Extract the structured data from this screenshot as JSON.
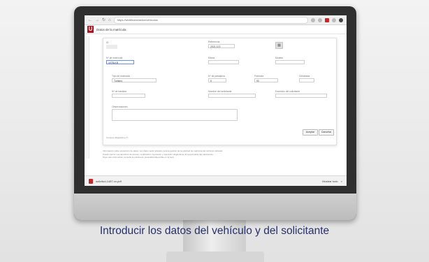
{
  "browser": {
    "url": "https://webfinanciacion/vehiculos",
    "nav_back": "←",
    "nav_forward": "→",
    "nav_reload": "↻",
    "nav_home": "⌂"
  },
  "app": {
    "logo_letter": "U",
    "dialog_title": "Datos de la matrícula"
  },
  "form": {
    "id_label": "ID",
    "id_value": "",
    "reference_label": "Referencia",
    "reference_value": "2021-123",
    "plate_label": "Nº de matrícula",
    "plate_value": "4478LKB",
    "brand_label": "Marca",
    "brand_value": "",
    "model_label": "Modelo",
    "model_value": "",
    "type_label": "Tipo de matrícula",
    "type_value": "Turismo",
    "passengers_label": "Nº de pasajeros",
    "passengers_value": "5",
    "cv_label": "Potencia",
    "cv_value": "90",
    "cc_label": "Cilindrada",
    "cc_value": "",
    "chassis_label": "Nº de bastidor",
    "chassis_value": "",
    "holder_label": "Nombre del solicitante",
    "holder_value": "",
    "address_label": "Domicilio del solicitante",
    "address_value": "",
    "notes_label": "Observaciones",
    "notes_value": ""
  },
  "buttons": {
    "accept": "Aceptar",
    "cancel": "Cancelar",
    "calendar": "▦"
  },
  "info": {
    "required_note": "Campos obligatorios (*)",
    "legal_1": "Información sobre protección de datos: sus datos serán tratados para la gestión de la solicitud de matrícula del vehículo indicado.",
    "legal_2": "Puede ejercer sus derechos de acceso, rectificación, supresión y oposición dirigiéndose al responsable del tratamiento.",
    "legal_3": "Para más información consulte la política de privacidad disponible en la web."
  },
  "download": {
    "file": "solicitud-1487-xx.pdf",
    "show_all": "Mostrar todo",
    "close": "×"
  },
  "caption": "Introducir los datos del vehículo y del solicitante"
}
